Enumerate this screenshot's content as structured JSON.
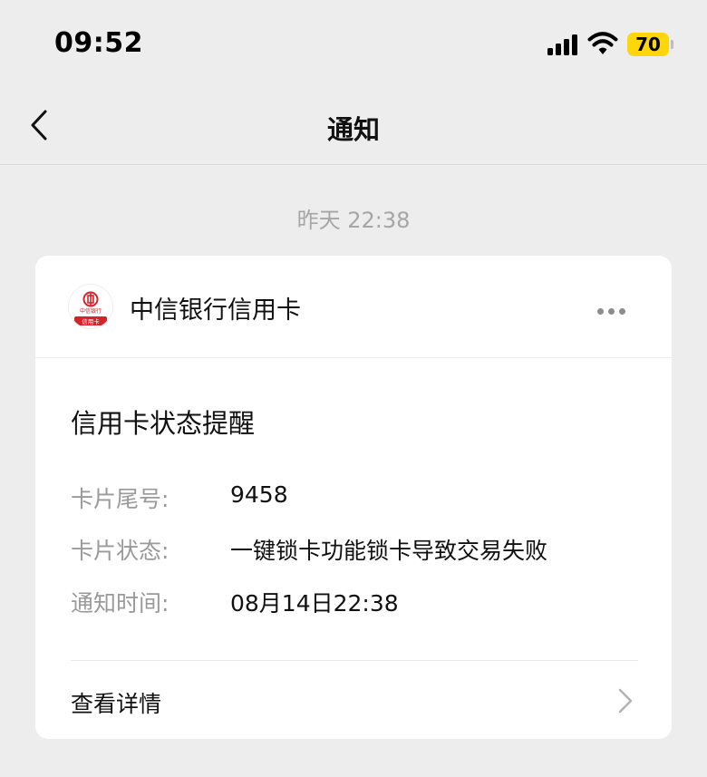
{
  "status_bar": {
    "time": "09:52",
    "battery_level": "70",
    "battery_color": "#ffd60a"
  },
  "nav": {
    "title": "通知",
    "back_icon": "chevron-left-icon"
  },
  "message": {
    "timestamp": "昨天 22:38"
  },
  "card": {
    "bank_name": "中信银行信用卡",
    "bank_logo_text": "中信银行",
    "bank_logo_badge": "信用卡",
    "brand_color": "#d7222a",
    "more_icon": "more-dots-icon",
    "notice_title": "信用卡状态提醒",
    "fields": [
      {
        "label": "卡片尾号:",
        "value": "9458"
      },
      {
        "label": "卡片状态:",
        "value": "一键锁卡功能锁卡导致交易失败"
      },
      {
        "label": "通知时间:",
        "value": "08月14日22:38"
      }
    ],
    "details_label": "查看详情",
    "details_icon": "chevron-right-icon"
  }
}
